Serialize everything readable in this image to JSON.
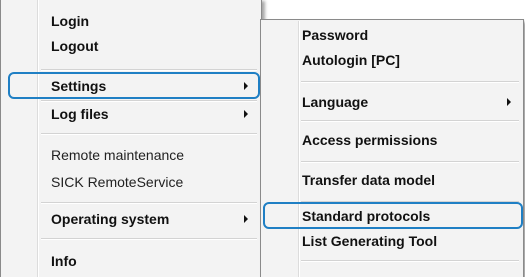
{
  "main_menu": {
    "items": [
      {
        "label": "Login"
      },
      {
        "label": "Logout"
      },
      {
        "label": "Settings"
      },
      {
        "label": "Log files"
      },
      {
        "label": "Remote maintenance"
      },
      {
        "label": "SICK RemoteService"
      },
      {
        "label": "Operating system"
      },
      {
        "label": "Info"
      }
    ],
    "highlighted_item": "Settings"
  },
  "sub_menu": {
    "items": [
      {
        "label": "Password"
      },
      {
        "label": "Autologin [PC]"
      },
      {
        "label": "Language"
      },
      {
        "label": "Access permissions"
      },
      {
        "label": "Transfer data model"
      },
      {
        "label": "Standard protocols"
      },
      {
        "label": "List Generating Tool"
      }
    ],
    "highlighted_item": "Standard protocols"
  },
  "colors": {
    "highlight_border": "#1f7fc4",
    "menu_background": "#f3f3f3"
  },
  "icons": {
    "submenu_arrow": "chevron-right-icon"
  }
}
